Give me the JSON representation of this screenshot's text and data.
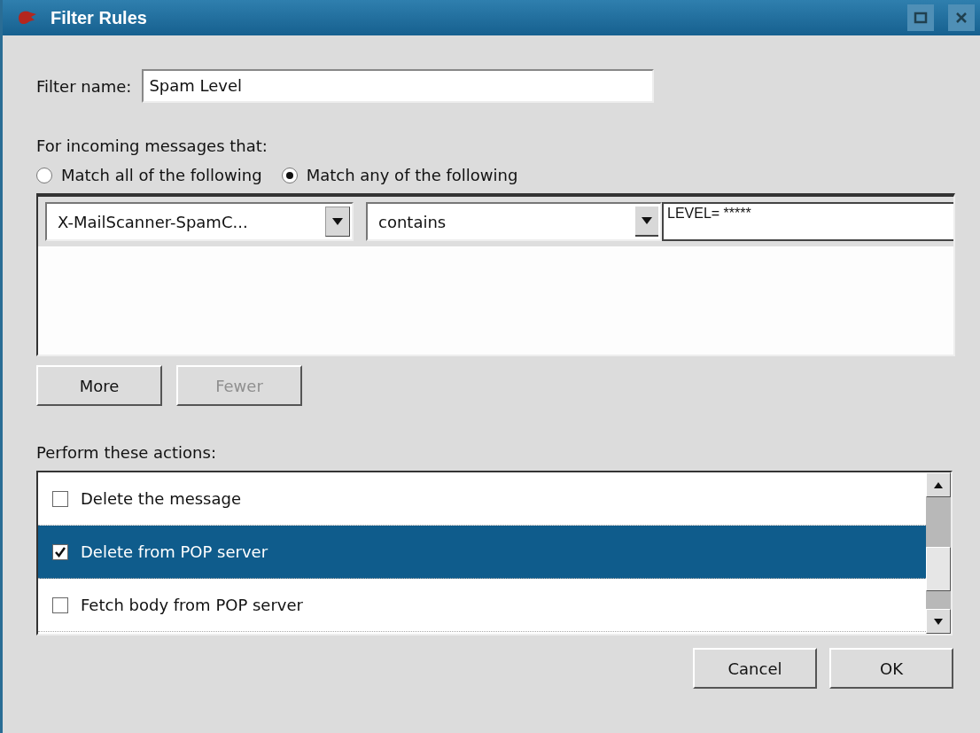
{
  "window": {
    "title": "Filter Rules"
  },
  "filter_name": {
    "label": "Filter name:",
    "value": "Spam Level"
  },
  "match": {
    "heading": "For incoming messages that:",
    "options": [
      {
        "label": "Match all of the following",
        "selected": false
      },
      {
        "label": "Match any of the following",
        "selected": true
      }
    ]
  },
  "rules": [
    {
      "field": "X-MailScanner-SpamC...",
      "operator": "contains",
      "value": "LEVEL= *****"
    }
  ],
  "rule_buttons": [
    {
      "label": "More",
      "disabled": false
    },
    {
      "label": "Fewer",
      "disabled": true
    }
  ],
  "actions": {
    "heading": "Perform these actions:",
    "items": [
      {
        "label": "Delete the message",
        "checked": false,
        "selected": false
      },
      {
        "label": "Delete from POP server",
        "checked": true,
        "selected": true
      },
      {
        "label": "Fetch body from POP server",
        "checked": false,
        "selected": false
      }
    ]
  },
  "buttons": [
    "Cancel",
    "OK"
  ]
}
